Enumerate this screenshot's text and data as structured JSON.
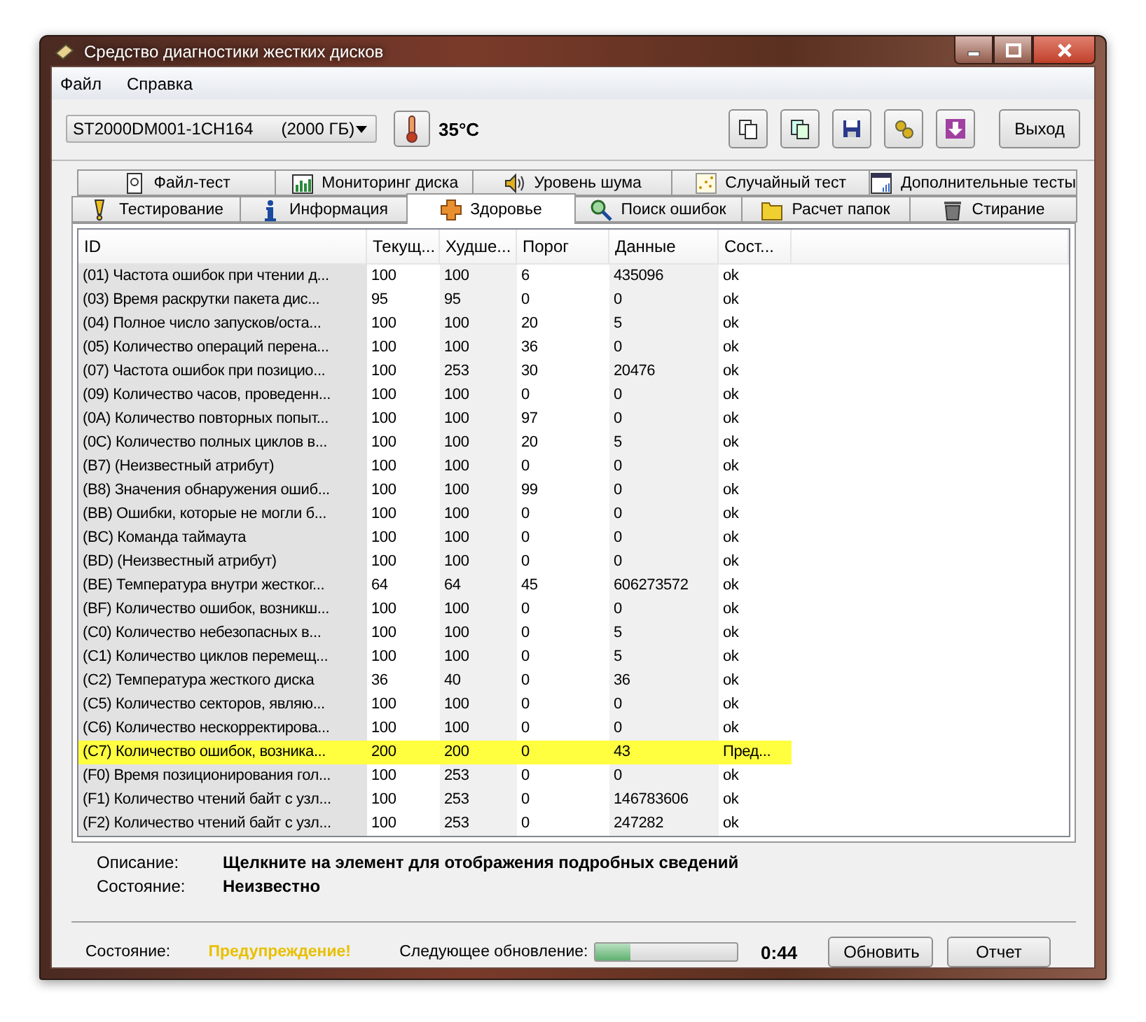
{
  "window": {
    "title": "Средство диагностики жестких дисков"
  },
  "menu": [
    "Файл",
    "Справка"
  ],
  "toolbar": {
    "drive": "ST2000DM001-1CH164      (2000 ГБ)",
    "temperature": "35°C",
    "exit_button": "Выход"
  },
  "tabs_top": [
    {
      "label": "Файл-тест",
      "selected": false
    },
    {
      "label": "Мониторинг диска",
      "selected": false
    },
    {
      "label": "Уровень шума",
      "selected": false
    },
    {
      "label": "Случайный тест",
      "selected": false
    },
    {
      "label": "Дополнительные тесты",
      "selected": false
    }
  ],
  "tabs_bottom": [
    {
      "label": "Тестирование",
      "selected": false
    },
    {
      "label": "Информация",
      "selected": false
    },
    {
      "label": "Здоровье",
      "selected": true
    },
    {
      "label": "Поиск ошибок",
      "selected": false
    },
    {
      "label": "Расчет папок",
      "selected": false
    },
    {
      "label": "Стирание",
      "selected": false
    }
  ],
  "table": {
    "columns": [
      "ID",
      "Текущ...",
      "Худше...",
      "Порог",
      "Данные",
      "Сост..."
    ],
    "rows": [
      {
        "cells": [
          "(01) Частота ошибок при чтении д...",
          "100",
          "100",
          "6",
          "435096",
          "ok"
        ],
        "warning": false
      },
      {
        "cells": [
          "(03) Время раскрутки пакета дис...",
          "95",
          "95",
          "0",
          "0",
          "ok"
        ],
        "warning": false
      },
      {
        "cells": [
          "(04) Полное число запусков/оста...",
          "100",
          "100",
          "20",
          "5",
          "ok"
        ],
        "warning": false
      },
      {
        "cells": [
          "(05) Количество операций перена...",
          "100",
          "100",
          "36",
          "0",
          "ok"
        ],
        "warning": false
      },
      {
        "cells": [
          "(07) Частота ошибок при позицио...",
          "100",
          "253",
          "30",
          "20476",
          "ok"
        ],
        "warning": false
      },
      {
        "cells": [
          "(09) Количество часов, проведенн...",
          "100",
          "100",
          "0",
          "0",
          "ok"
        ],
        "warning": false
      },
      {
        "cells": [
          "(0A) Количество повторных попыт...",
          "100",
          "100",
          "97",
          "0",
          "ok"
        ],
        "warning": false
      },
      {
        "cells": [
          "(0C) Количество полных циклов в...",
          "100",
          "100",
          "20",
          "5",
          "ok"
        ],
        "warning": false
      },
      {
        "cells": [
          "(B7) (Неизвестный атрибут)",
          "100",
          "100",
          "0",
          "0",
          "ok"
        ],
        "warning": false
      },
      {
        "cells": [
          "(B8) Значения обнаружения ошиб...",
          "100",
          "100",
          "99",
          "0",
          "ok"
        ],
        "warning": false
      },
      {
        "cells": [
          "(BB) Ошибки, которые не могли б...",
          "100",
          "100",
          "0",
          "0",
          "ok"
        ],
        "warning": false
      },
      {
        "cells": [
          "(BC) Команда таймаута",
          "100",
          "100",
          "0",
          "0",
          "ok"
        ],
        "warning": false
      },
      {
        "cells": [
          "(BD) (Неизвестный атрибут)",
          "100",
          "100",
          "0",
          "0",
          "ok"
        ],
        "warning": false
      },
      {
        "cells": [
          "(BE) Температура внутри жестког...",
          "64",
          "64",
          "45",
          "606273572",
          "ok"
        ],
        "warning": false
      },
      {
        "cells": [
          "(BF) Количество ошибок, возникш...",
          "100",
          "100",
          "0",
          "0",
          "ok"
        ],
        "warning": false
      },
      {
        "cells": [
          "(C0) Количество небезопасных в...",
          "100",
          "100",
          "0",
          "5",
          "ok"
        ],
        "warning": false
      },
      {
        "cells": [
          "(C1) Количество циклов перемещ...",
          "100",
          "100",
          "0",
          "5",
          "ok"
        ],
        "warning": false
      },
      {
        "cells": [
          "(C2) Температура жесткого диска",
          "36",
          "40",
          "0",
          "36",
          "ok"
        ],
        "warning": false
      },
      {
        "cells": [
          "(C5) Количество секторов, являю...",
          "100",
          "100",
          "0",
          "0",
          "ok"
        ],
        "warning": false
      },
      {
        "cells": [
          "(C6) Количество нескорректирова...",
          "100",
          "100",
          "0",
          "0",
          "ok"
        ],
        "warning": false
      },
      {
        "cells": [
          "(C7) Количество ошибок, возника...",
          "200",
          "200",
          "0",
          "43",
          "Пред..."
        ],
        "warning": true
      },
      {
        "cells": [
          "(F0) Время позиционирования гол...",
          "100",
          "253",
          "0",
          "0",
          "ok"
        ],
        "warning": false
      },
      {
        "cells": [
          "(F1) Количество чтений байт с узл...",
          "100",
          "253",
          "0",
          "146783606",
          "ok"
        ],
        "warning": false
      },
      {
        "cells": [
          "(F2) Количество чтений байт с узл...",
          "100",
          "253",
          "0",
          "247282",
          "ok"
        ],
        "warning": false
      }
    ]
  },
  "details": [
    {
      "label": "Описание:",
      "value": "Щелкните на элемент для отображения подробных сведений"
    },
    {
      "label": "Состояние:",
      "value": "Неизвестно"
    }
  ],
  "status_bar": {
    "label": "Состояние:",
    "value": "Предупреждение!",
    "next_update_label": "Следующее обновление:",
    "progress": {
      "level": 0.25
    },
    "countdown": "0:44",
    "buttons": [
      "Обновить",
      "Отчет"
    ]
  }
}
